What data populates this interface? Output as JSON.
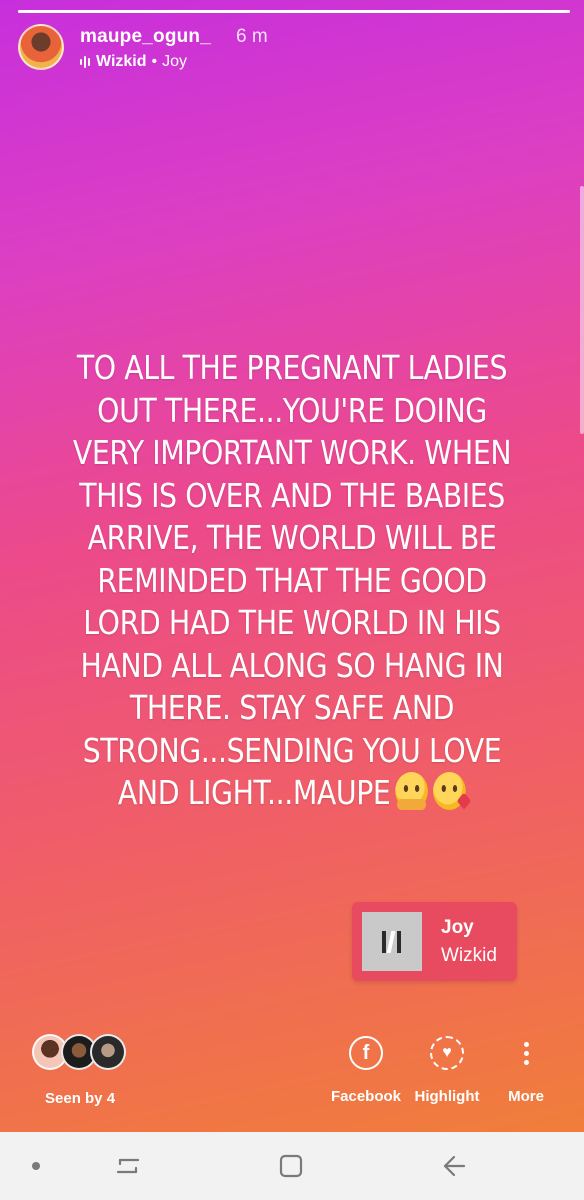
{
  "story": {
    "progress": 1.0,
    "username": "maupe_ogun_",
    "time_ago": "6 m",
    "music_artist": "Wizkid",
    "music_separator": "•",
    "music_title": "Joy",
    "message": "TO ALL THE PREGNANT LADIES OUT THERE...YOU'RE DOING VERY IMPORTANT WORK. WHEN THIS IS OVER AND THE BABIES ARRIVE, THE WORLD WILL BE REMINDED THAT THE GOOD LORD HAD THE WORLD IN HIS HAND ALL ALONG SO HANG IN THERE. STAY SAFE AND STRONG...SENDING YOU LOVE AND LIGHT...MAUPE",
    "emojis": [
      "hugging-face-emoji",
      "face-blowing-kiss-emoji"
    ]
  },
  "sticker": {
    "title": "Joy",
    "artist": "Wizkid",
    "album_icon": "music-logo-icon",
    "bg_color": "#e84a5f"
  },
  "footer": {
    "seen_by": "Seen by 4",
    "actions": [
      {
        "label": "Facebook",
        "icon": "facebook-icon"
      },
      {
        "label": "Highlight",
        "icon": "highlight-heart-icon"
      },
      {
        "label": "More",
        "icon": "more-vertical-icon"
      }
    ]
  },
  "navbar": {
    "icons": [
      "home-dot-icon",
      "recents-icon",
      "home-icon",
      "back-icon"
    ]
  },
  "colors": {
    "gradient_top": "#c72fdc",
    "gradient_mid": "#ec4a8a",
    "gradient_bottom": "#f07e3a",
    "navbar_bg": "#f2f2f2"
  }
}
